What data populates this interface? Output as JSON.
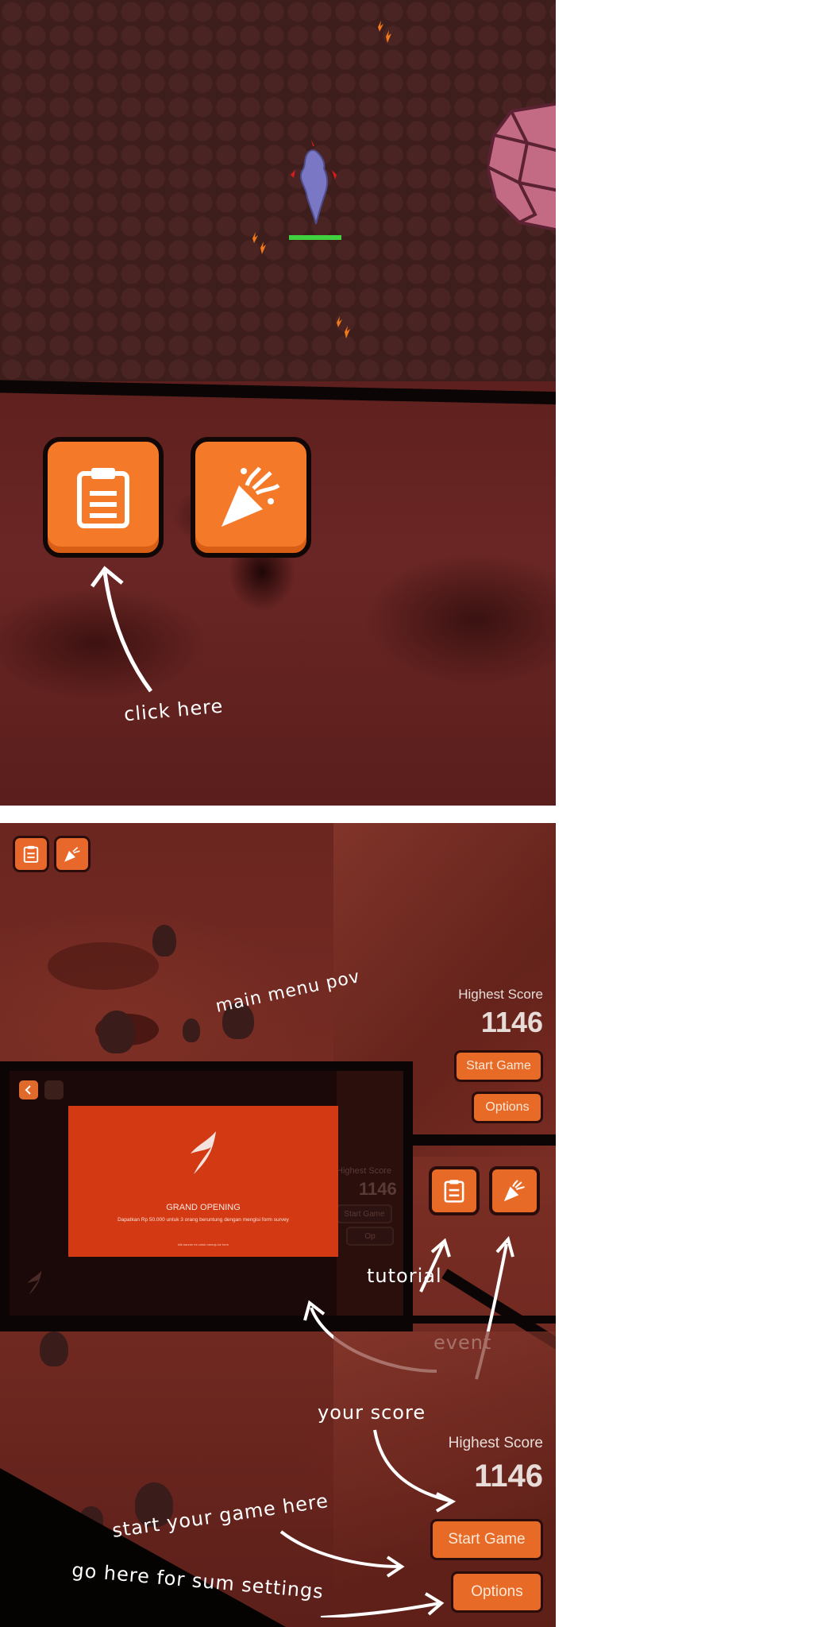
{
  "panel1": {
    "annotation": "click here"
  },
  "menu": {
    "annotation": "main menu pov",
    "score_label": "Highest Score",
    "score_value": "1146",
    "start_label": "Start Game",
    "options_label": "Options"
  },
  "event_popup": {
    "title": "GRAND OPENING",
    "description": "Dapatkan Rp 50.000 untuk 3 orang beruntung dengan mengisi form survey",
    "fine_print": "klik banner ini untuk menuju ke form",
    "bg_score_label": "Highest Score",
    "bg_score_value": "1146",
    "bg_start_label": "Start Game",
    "bg_options_label": "Op"
  },
  "annotations": {
    "tutorial": "tutorial",
    "event": "event",
    "your_score": "your score",
    "start_game": "start your game here",
    "settings": "go here for sum settings"
  },
  "bottom": {
    "score_label": "Highest Score",
    "score_value": "1146",
    "start_label": "Start Game",
    "options_label": "Options"
  },
  "colors": {
    "accent": "#f47a2a",
    "event_red": "#d33a14",
    "health_bar": "#3fd13f"
  },
  "icons": [
    "clipboard-icon",
    "party-popper-icon",
    "chevron-left-icon",
    "pencil-icon",
    "blade-logo-icon"
  ]
}
